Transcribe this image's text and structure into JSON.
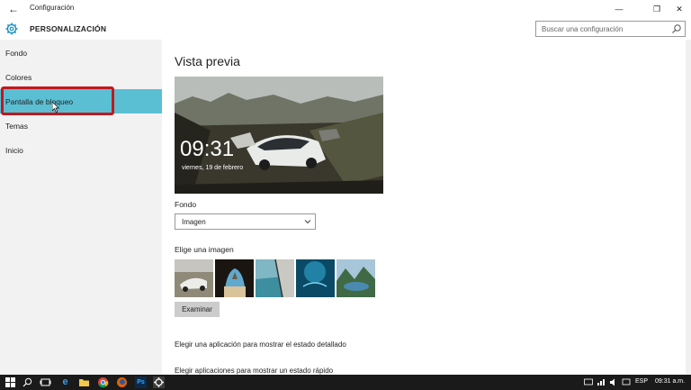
{
  "titlebar": {
    "title": "Configuración"
  },
  "header": {
    "title": "PERSONALIZACIÓN",
    "search_placeholder": "Buscar una configuración"
  },
  "sidebar": {
    "items": [
      {
        "label": "Fondo",
        "active": false
      },
      {
        "label": "Colores",
        "active": false
      },
      {
        "label": "Pantalla de bloqueo",
        "active": true
      },
      {
        "label": "Temas",
        "active": false
      },
      {
        "label": "Inicio",
        "active": false
      }
    ]
  },
  "main": {
    "title": "Vista previa",
    "preview": {
      "time": "09:31",
      "date": "viernes, 19 de febrero"
    },
    "background_label": "Fondo",
    "background_value": "Imagen",
    "choose_image_label": "Elige una imagen",
    "browse_button": "Examinar",
    "detail_app_link": "Elegir una aplicación para mostrar el estado detallado",
    "quick_apps_link": "Elegir aplicaciones para mostrar un estado rápido"
  },
  "taskbar": {
    "language": "ESP",
    "time": "09:31 a.m."
  },
  "colors": {
    "accent": "#5bbfd4",
    "highlight_box": "#c2181e",
    "taskbar": "#1a1a1a"
  }
}
